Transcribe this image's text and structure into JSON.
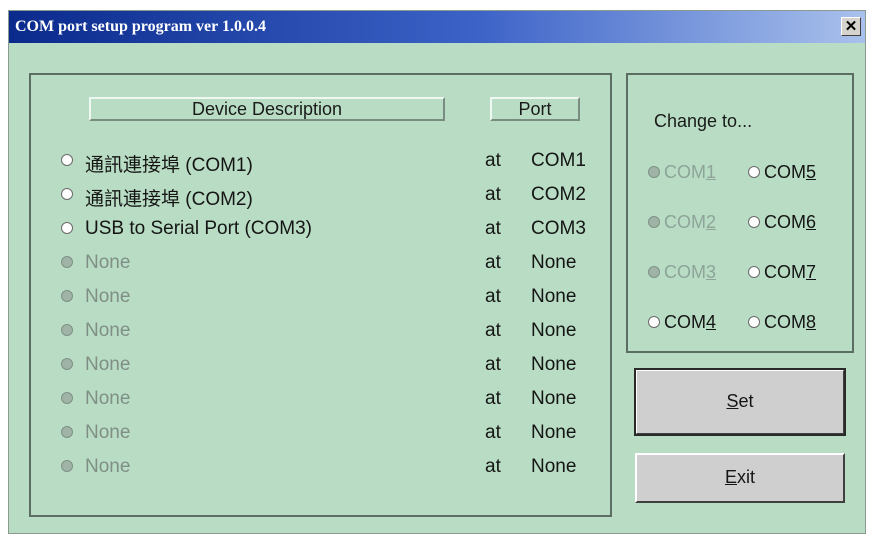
{
  "window": {
    "title": "COM port setup program ver 1.0.0.4",
    "close_glyph": "✕"
  },
  "devices": {
    "header_description": "Device Description",
    "header_port": "Port",
    "rows": [
      {
        "description": "通訊連接埠 (COM1)",
        "at": "at",
        "port": "COM1",
        "enabled": true
      },
      {
        "description": "通訊連接埠 (COM2)",
        "at": "at",
        "port": "COM2",
        "enabled": true
      },
      {
        "description": "USB to Serial Port (COM3)",
        "at": "at",
        "port": "COM3",
        "enabled": true
      },
      {
        "description": "None",
        "at": "at",
        "port": "None",
        "enabled": false
      },
      {
        "description": "None",
        "at": "at",
        "port": "None",
        "enabled": false
      },
      {
        "description": "None",
        "at": "at",
        "port": "None",
        "enabled": false
      },
      {
        "description": "None",
        "at": "at",
        "port": "None",
        "enabled": false
      },
      {
        "description": "None",
        "at": "at",
        "port": "None",
        "enabled": false
      },
      {
        "description": "None",
        "at": "at",
        "port": "None",
        "enabled": false
      },
      {
        "description": "None",
        "at": "at",
        "port": "None",
        "enabled": false
      }
    ]
  },
  "change_to": {
    "label": "Change to...",
    "options": [
      {
        "prefix": "COM",
        "digit": "1",
        "enabled": false
      },
      {
        "prefix": "COM",
        "digit": "5",
        "enabled": true
      },
      {
        "prefix": "COM",
        "digit": "2",
        "enabled": false
      },
      {
        "prefix": "COM",
        "digit": "6",
        "enabled": true
      },
      {
        "prefix": "COM",
        "digit": "3",
        "enabled": false
      },
      {
        "prefix": "COM",
        "digit": "7",
        "enabled": true
      },
      {
        "prefix": "COM",
        "digit": "4",
        "enabled": true
      },
      {
        "prefix": "COM",
        "digit": "8",
        "enabled": true
      }
    ]
  },
  "buttons": {
    "set": {
      "mnemonic": "S",
      "rest": "et"
    },
    "exit": {
      "mnemonic": "E",
      "rest": "xit"
    }
  }
}
